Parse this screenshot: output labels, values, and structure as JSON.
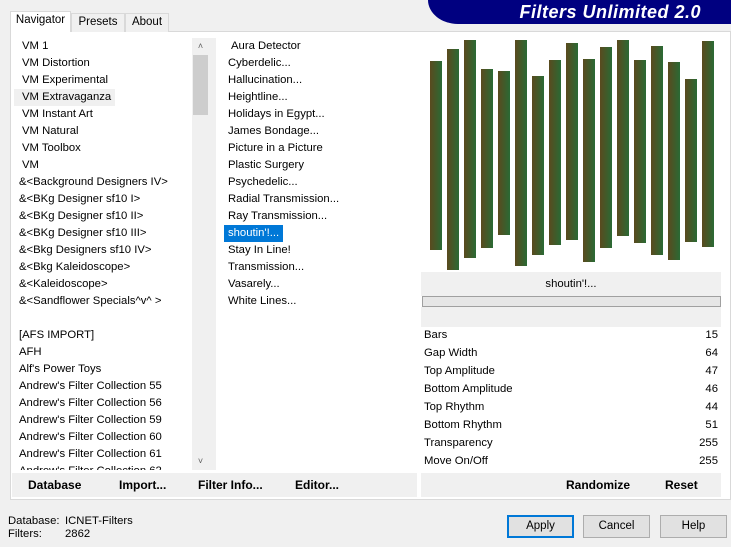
{
  "title": "Filters Unlimited 2.0",
  "tabs": [
    "Navigator",
    "Presets",
    "About"
  ],
  "categories": [
    "VM 1",
    "VM Distortion",
    "VM Experimental",
    "VM Extravaganza",
    "VM Instant Art",
    "VM Natural",
    "VM Toolbox",
    "VM",
    "&<Background Designers IV>",
    "&<BKg Designer sf10 I>",
    "&<BKg Designer sf10 II>",
    "&<BKg Designer sf10 III>",
    "&<Bkg Designers sf10 IV>",
    "&<Bkg Kaleidoscope>",
    "&<Kaleidoscope>",
    "&<Sandflower Specials^v^ >",
    "",
    "[AFS IMPORT]",
    "AFH",
    "Alf's Power Toys",
    "Andrew's Filter Collection 55",
    "Andrew's Filter Collection 56",
    "Andrew's Filter Collection 59",
    "Andrew's Filter Collection 60",
    "Andrew's Filter Collection 61"
  ],
  "selected_category": "VM Extravaganza",
  "filters": [
    "Aura Detector",
    "Cyberdelic...",
    "Hallucination...",
    "Heightline...",
    "Holidays in Egypt...",
    "James Bondage...",
    "Picture in a Picture",
    "Plastic Surgery",
    "Psychedelic...",
    "Radial Transmission...",
    "Ray Transmission...",
    "shoutin'!...",
    "Stay In Line!",
    "Transmission...",
    "Vasarely...",
    "White Lines..."
  ],
  "selected_filter": "shoutin'!...",
  "filter_label": "shoutin'!...",
  "params": [
    {
      "name": "Bars",
      "value": "15"
    },
    {
      "name": "Gap Width",
      "value": "64"
    },
    {
      "name": "Top Amplitude",
      "value": "47"
    },
    {
      "name": "Bottom Amplitude",
      "value": "46"
    },
    {
      "name": "Top Rhythm",
      "value": "44"
    },
    {
      "name": "Bottom Rhythm",
      "value": "51"
    },
    {
      "name": "Transparency",
      "value": "255"
    },
    {
      "name": "Move On/Off",
      "value": "255"
    }
  ],
  "buttons": {
    "database": "Database",
    "import": "Import...",
    "filter_info": "Filter Info...",
    "editor": "Editor...",
    "randomize": "Randomize",
    "reset": "Reset",
    "apply": "Apply",
    "cancel": "Cancel",
    "help": "Help"
  },
  "status": {
    "db_label": "Database:",
    "db_value": "ICNET-Filters",
    "filters_label": "Filters:",
    "filters_value": "2862"
  }
}
